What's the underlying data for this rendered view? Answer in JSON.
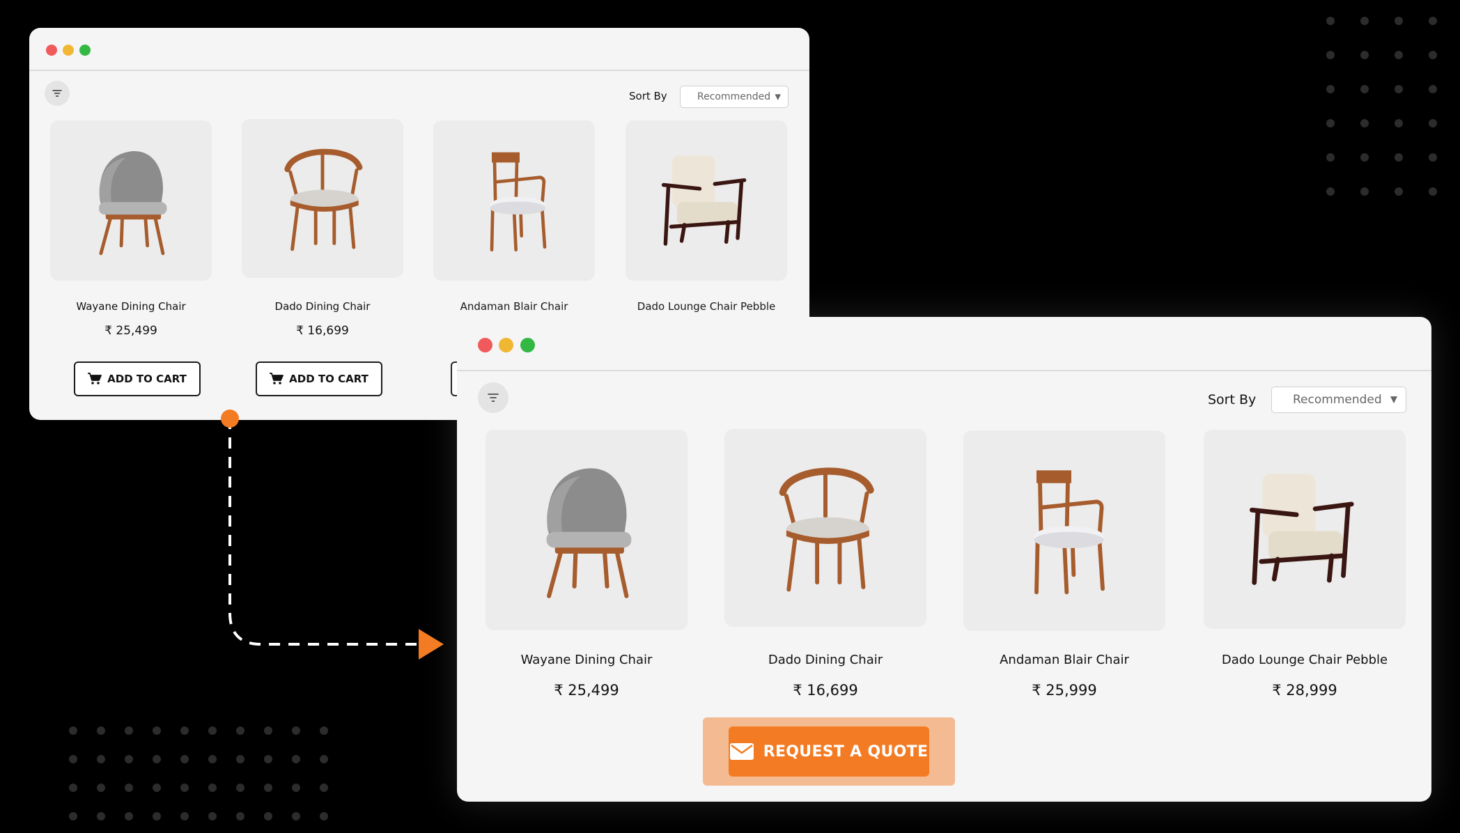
{
  "colors": {
    "accent": "#f37b23",
    "accent_light": "#f4bb93",
    "window_bg": "#f5f5f5",
    "page_bg": "#000000"
  },
  "back_window": {
    "sort_label": "Sort By",
    "sort_value": "Recommended",
    "cart_label": "ADD TO CART",
    "products": [
      {
        "name": "Wayane Dining Chair",
        "price": "₹ 25,499",
        "icon": "grey-upholstered-chair"
      },
      {
        "name": "Dado Dining Chair",
        "price": "₹ 16,699",
        "icon": "wooden-bentwood-chair"
      },
      {
        "name": "Andaman Blair Chair",
        "icon": "wooden-armchair"
      },
      {
        "name": "Dado Lounge Chair Pebble",
        "icon": "lounge-chair"
      }
    ]
  },
  "front_window": {
    "sort_label": "Sort By",
    "sort_value": "Recommended",
    "quote_label": "REQUEST A QUOTE",
    "products": [
      {
        "name": "Wayane Dining Chair",
        "price": "₹ 25,499",
        "icon": "grey-upholstered-chair"
      },
      {
        "name": "Dado Dining Chair",
        "price": "₹ 16,699",
        "icon": "wooden-bentwood-chair"
      },
      {
        "name": "Andaman Blair Chair",
        "price": "₹ 25,999",
        "icon": "wooden-armchair"
      },
      {
        "name": "Dado Lounge Chair Pebble",
        "price": "₹ 28,999",
        "icon": "lounge-chair"
      }
    ]
  }
}
